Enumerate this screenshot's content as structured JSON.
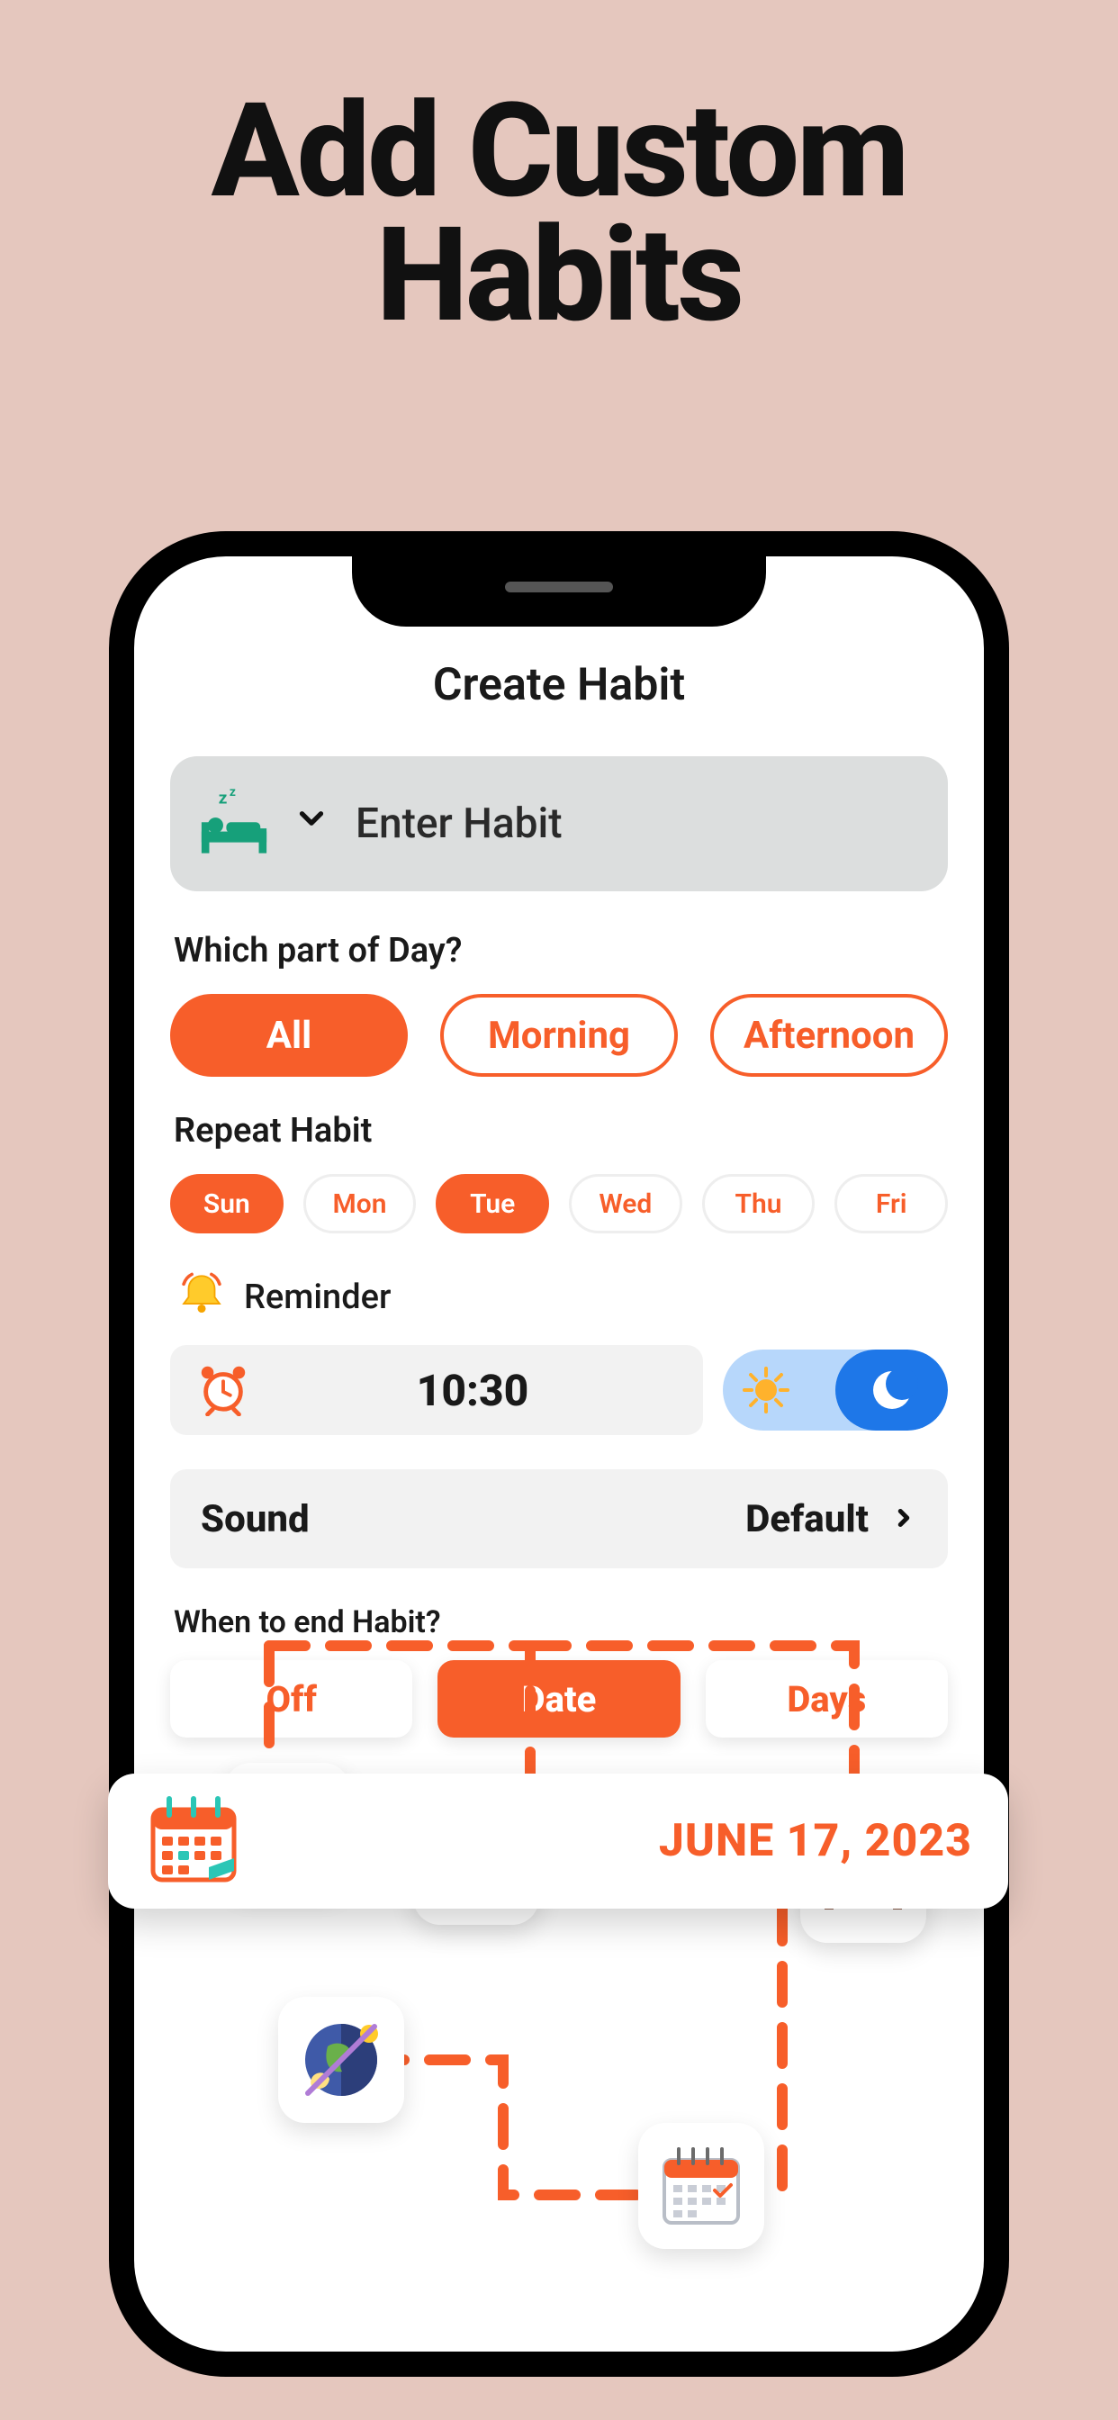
{
  "promo": {
    "line1": "Add Custom",
    "line2": "Habits"
  },
  "screen": {
    "title": "Create Habit",
    "habit_input": {
      "placeholder": "Enter Habit",
      "icon": "sleep-bed-icon"
    },
    "part_of_day": {
      "label": "Which part of Day?",
      "options": [
        {
          "label": "All",
          "selected": true
        },
        {
          "label": "Morning",
          "selected": false
        },
        {
          "label": "Afternoon",
          "selected": false
        }
      ]
    },
    "repeat": {
      "label": "Repeat Habit",
      "days": [
        {
          "label": "Sun",
          "selected": true
        },
        {
          "label": "Mon",
          "selected": false
        },
        {
          "label": "Tue",
          "selected": true
        },
        {
          "label": "Wed",
          "selected": false
        },
        {
          "label": "Thu",
          "selected": false
        },
        {
          "label": "Fri",
          "selected": false
        }
      ]
    },
    "reminder": {
      "label": "Reminder",
      "time": "10:30",
      "daynight": "night"
    },
    "sound": {
      "label": "Sound",
      "value": "Default"
    },
    "end": {
      "label": "When to end Habit?",
      "options": [
        {
          "label": "Off",
          "selected": false
        },
        {
          "label": "Date",
          "selected": true
        },
        {
          "label": "Days",
          "selected": false
        }
      ]
    }
  },
  "callout": {
    "date": "JUNE 17, 2023"
  },
  "colors": {
    "accent": "#F75E2A",
    "bg": "#E5C7BE",
    "input_bg": "#DCDEDE",
    "toggle_bg": "#B7D7FB",
    "toggle_on": "#1E77E8",
    "bed": "#16A07A"
  }
}
